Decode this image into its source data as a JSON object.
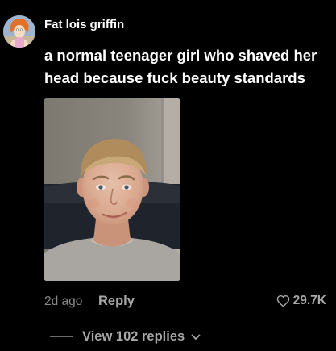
{
  "comment": {
    "username": "Fat lois griffin",
    "text": "a normal teenager girl who shaved her head because fuck beauty standards",
    "timestamp": "2d ago",
    "reply_label": "Reply",
    "like_count": "29.7K",
    "view_replies_label": "View 102 replies",
    "icons": {
      "avatar": "avatar-cartoon",
      "like": "heart-outline-icon",
      "expand": "chevron-down-icon"
    }
  },
  "colors": {
    "background": "#000000",
    "text_primary": "#ffffff",
    "text_secondary": "#a8a8a8",
    "text_tertiary": "#8a8a8a"
  }
}
